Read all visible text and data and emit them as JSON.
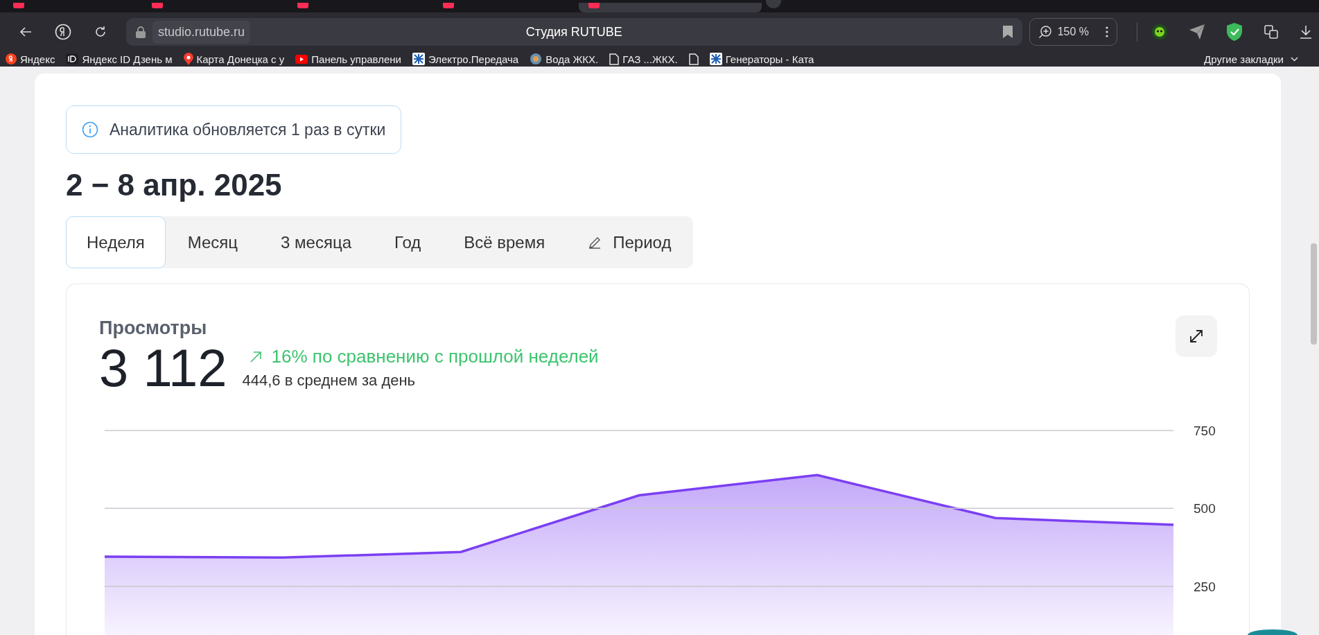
{
  "browser": {
    "tabs": [
      {
        "selected": false
      },
      {
        "selected": false
      },
      {
        "selected": false
      },
      {
        "selected": false
      },
      {
        "selected": true
      }
    ],
    "address": "studio.rutube.ru",
    "page_title": "Студия RUTUBE",
    "zoom": "150 %",
    "bookmarks": [
      {
        "label": "Яндекс",
        "kind": "ya"
      },
      {
        "label": "Яндекс ID Дзень м",
        "kind": "id"
      },
      {
        "label": "Карта Донецка с у",
        "kind": "pin"
      },
      {
        "label": "Панель управлени",
        "kind": "video"
      },
      {
        "label": "Электро.Передача",
        "kind": "logo"
      },
      {
        "label": "Вода  ЖКХ.",
        "kind": "globe"
      },
      {
        "label": "ГАЗ ...ЖКХ.",
        "kind": "page"
      },
      {
        "kind": "page"
      },
      {
        "label": "Генераторы - Ката",
        "kind": "logo"
      }
    ],
    "other_bookmarks": "Другие закладки"
  },
  "notice": "Аналитика обновляется 1 раз в сутки",
  "period_title": "2 − 8 апр. 2025",
  "period_tabs": [
    {
      "label": "Неделя",
      "selected": true,
      "kind": "preset"
    },
    {
      "label": "Месяц",
      "selected": false,
      "kind": "preset"
    },
    {
      "label": "3 месяца",
      "selected": false,
      "kind": "preset"
    },
    {
      "label": "Год",
      "selected": false,
      "kind": "preset"
    },
    {
      "label": "Всё время",
      "selected": false,
      "kind": "preset"
    },
    {
      "label": "Период",
      "selected": false,
      "kind": "custom"
    }
  ],
  "views": {
    "title": "Просмотры",
    "total": "3 112",
    "change": "16% по сравнению с прошлой неделей",
    "average": "444,6 в среднем за день",
    "chart_data": {
      "type": "area",
      "ylim": [
        0,
        750
      ],
      "yticks": [
        250,
        500,
        750
      ],
      "series": [
        {
          "color": "#7b3ff2",
          "values": [
            345,
            342,
            360,
            542,
            607,
            469,
            447
          ]
        }
      ]
    }
  }
}
